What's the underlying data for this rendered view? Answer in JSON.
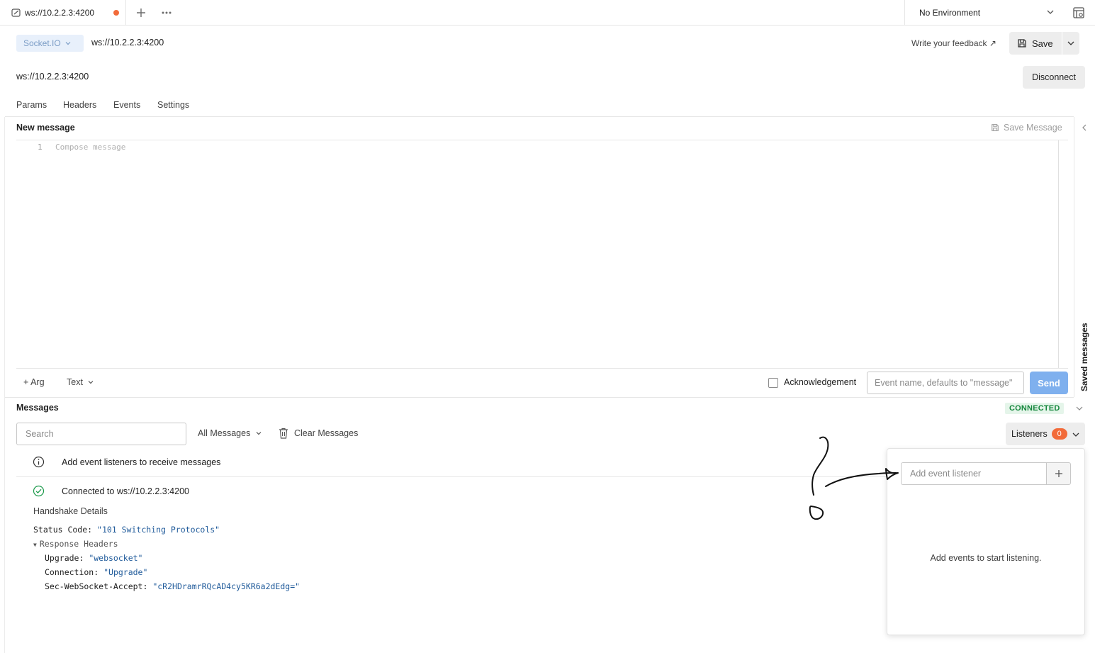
{
  "tab": {
    "title": "ws://10.2.2.3:4200",
    "unsaved": true
  },
  "environment": {
    "selected": "No Environment"
  },
  "request": {
    "protocol": "Socket.IO",
    "url": "ws://10.2.2.3:4200",
    "feedback_label": "Write your feedback ↗",
    "save_label": "Save"
  },
  "connection": {
    "url": "ws://10.2.2.3:4200",
    "disconnect_label": "Disconnect"
  },
  "request_tabs": [
    "Params",
    "Headers",
    "Events",
    "Settings"
  ],
  "composer": {
    "title": "New message",
    "save_message_label": "Save Message",
    "line_number": "1",
    "placeholder": "Compose message",
    "arg_label": "+ Arg",
    "format": "Text",
    "ack_label": "Acknowledgement",
    "ack_checked": false,
    "event_placeholder": "Event name, defaults to \"message\"",
    "send_label": "Send"
  },
  "side_panel": {
    "label": "Saved messages"
  },
  "messages": {
    "title": "Messages",
    "status": "CONNECTED",
    "search_placeholder": "Search",
    "filter": "All Messages",
    "clear_label": "Clear Messages",
    "listeners_label": "Listeners",
    "listeners_count": "0",
    "info_text": "Add event listeners to receive messages",
    "connected_text": "Connected to ws://10.2.2.3:4200",
    "handshake": {
      "title": "Handshake Details",
      "status_key": "Status Code: ",
      "status_value": "\"101 Switching Protocols\"",
      "response_headers_label": "Response Headers",
      "headers": [
        {
          "key": "Upgrade: ",
          "value": "\"websocket\""
        },
        {
          "key": "Connection: ",
          "value": "\"Upgrade\""
        },
        {
          "key": "Sec-WebSocket-Accept: ",
          "value": "\"cR2HDramrRQcAD4cy5KR6a2dEdg=\""
        }
      ]
    }
  },
  "listeners_popover": {
    "input_placeholder": "Add event listener",
    "empty_text": "Add events to start listening."
  },
  "colors": {
    "accent_orange": "#f26b3a",
    "send_blue": "#7fb0ee",
    "connected_green": "#16873d",
    "string_blue": "#1f5a9a"
  }
}
